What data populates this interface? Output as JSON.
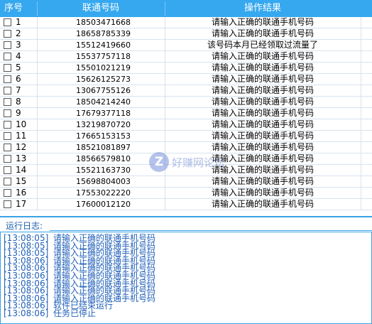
{
  "table": {
    "columns": [
      "序号",
      "联通号码",
      "操作结果"
    ],
    "rows": [
      {
        "index": "1",
        "phone": "18503471668",
        "result": "请输入正确的联通手机号码"
      },
      {
        "index": "2",
        "phone": "18658785339",
        "result": "请输入正确的联通手机号码"
      },
      {
        "index": "3",
        "phone": "15512419660",
        "result": "该号码本月已经领取过流量了"
      },
      {
        "index": "4",
        "phone": "15537757118",
        "result": "请输入正确的联通手机号码"
      },
      {
        "index": "5",
        "phone": "15501021219",
        "result": "请输入正确的联通手机号码"
      },
      {
        "index": "6",
        "phone": "15626125273",
        "result": "请输入正确的联通手机号码"
      },
      {
        "index": "7",
        "phone": "13067755126",
        "result": "请输入正确的联通手机号码"
      },
      {
        "index": "8",
        "phone": "18504214240",
        "result": "请输入正确的联通手机号码"
      },
      {
        "index": "9",
        "phone": "17679377118",
        "result": "请输入正确的联通手机号码"
      },
      {
        "index": "10",
        "phone": "13219870720",
        "result": "请输入正确的联通手机号码"
      },
      {
        "index": "11",
        "phone": "17665153153",
        "result": "请输入正确的联通手机号码"
      },
      {
        "index": "12",
        "phone": "18521081897",
        "result": "请输入正确的联通手机号码"
      },
      {
        "index": "13",
        "phone": "18566579810",
        "result": "请输入正确的联通手机号码"
      },
      {
        "index": "14",
        "phone": "15521163730",
        "result": "请输入正确的联通手机号码"
      },
      {
        "index": "15",
        "phone": "15698804003",
        "result": "请输入正确的联通手机号码"
      },
      {
        "index": "16",
        "phone": "17553022220",
        "result": "请输入正确的联通手机号码"
      },
      {
        "index": "17",
        "phone": "17600012120",
        "result": "请输入正确的联通手机号码"
      }
    ]
  },
  "watermark": {
    "logo": "Z",
    "text": "好赚网论坛"
  },
  "log": {
    "title": "运行日志:",
    "entries": [
      {
        "time": "[13:08:05]",
        "message": "请输入正确的联通手机号码"
      },
      {
        "time": "[13:08:05]",
        "message": "请输入正确的联通手机号码"
      },
      {
        "time": "[13:08:05]",
        "message": "请输入正确的联通手机号码"
      },
      {
        "time": "[13:08:06]",
        "message": "请输入正确的联通手机号码"
      },
      {
        "time": "[13:08:06]",
        "message": "请输入正确的联通手机号码"
      },
      {
        "time": "[13:08:06]",
        "message": "请输入正确的联通手机号码"
      },
      {
        "time": "[13:08:06]",
        "message": "请输入正确的联通手机号码"
      },
      {
        "time": "[13:08:06]",
        "message": "请输入正确的联通手机号码"
      },
      {
        "time": "[13:08:06]",
        "message": "请输入正确的联通手机号码"
      },
      {
        "time": "[13:08:06]",
        "message": "软件已结束运行"
      },
      {
        "time": "[13:08:06]",
        "message": "任务已停止"
      }
    ]
  }
}
